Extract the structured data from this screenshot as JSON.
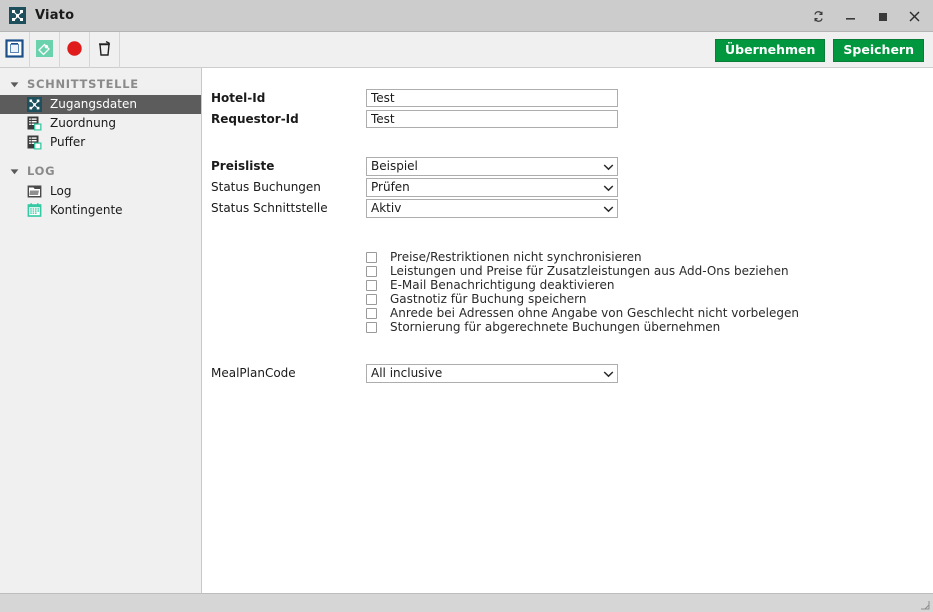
{
  "window": {
    "title": "Viato",
    "app_icon": "network-nodes-icon",
    "controls": [
      {
        "name": "restore-button",
        "icon": "restore-icon"
      },
      {
        "name": "minimize-button",
        "icon": "minimize-icon"
      },
      {
        "name": "maximize-button",
        "icon": "maximize-icon"
      },
      {
        "name": "close-button",
        "icon": "close-icon"
      }
    ]
  },
  "toolbar": {
    "buttons": [
      {
        "name": "new-document-button",
        "icon": "clipboard-blue-icon"
      },
      {
        "name": "tag-button",
        "icon": "tag-green-icon"
      },
      {
        "name": "record-button",
        "icon": "record-red-circle-icon"
      },
      {
        "name": "delete-button",
        "icon": "trash-icon"
      }
    ],
    "apply_label": "Übernehmen",
    "save_label": "Speichern",
    "accent_green": "#00973f"
  },
  "sidebar": {
    "sections": [
      {
        "title": "SCHNITTSTELLE",
        "expanded": true,
        "items": [
          {
            "label": "Zugangsdaten",
            "icon": "network-nodes-icon",
            "selected": true
          },
          {
            "label": "Zuordnung",
            "icon": "clipboard-list-icon",
            "selected": false
          },
          {
            "label": "Puffer",
            "icon": "clipboard-list-icon",
            "selected": false
          }
        ]
      },
      {
        "title": "LOG",
        "expanded": true,
        "items": [
          {
            "label": "Log",
            "icon": "folder-log-icon",
            "selected": false
          },
          {
            "label": "Kontingente",
            "icon": "calendar-icon",
            "selected": false
          }
        ]
      }
    ],
    "selected_bg": "#5c5c5c"
  },
  "form": {
    "hotel_id": {
      "label": "Hotel-Id",
      "value": "Test"
    },
    "requestor_id": {
      "label": "Requestor-Id",
      "value": "Test"
    },
    "preisliste": {
      "label": "Preisliste",
      "value": "Beispiel"
    },
    "status_buchungen": {
      "label": "Status Buchungen",
      "value": "Prüfen"
    },
    "status_schnittstelle": {
      "label": "Status Schnittstelle",
      "value": "Aktiv"
    },
    "mealplancode": {
      "label": "MealPlanCode",
      "value": "All inclusive"
    },
    "checkboxes": [
      {
        "label": "Preise/Restriktionen nicht synchronisieren",
        "checked": false
      },
      {
        "label": "Leistungen und Preise für Zusatzleistungen aus Add-Ons beziehen",
        "checked": false
      },
      {
        "label": "E-Mail Benachrichtigung deaktivieren",
        "checked": false
      },
      {
        "label": "Gastnotiz für Buchung speichern",
        "checked": false
      },
      {
        "label": "Anrede bei Adressen ohne Angabe von Geschlecht nicht vorbelegen",
        "checked": false
      },
      {
        "label": "Stornierung für abgerechnete Buchungen übernehmen",
        "checked": false
      }
    ]
  },
  "statusbar": {
    "text": "",
    "grip": "resize-grip-icon"
  }
}
